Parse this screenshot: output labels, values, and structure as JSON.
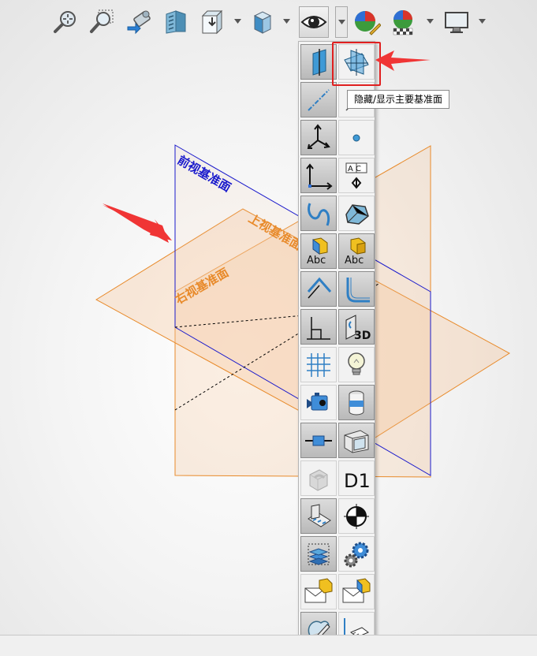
{
  "viewport": {
    "planes": {
      "front": {
        "label": "前视基准面",
        "color": "#1a1acc"
      },
      "top": {
        "label": "上视基准面",
        "color": "#e88a2a"
      },
      "right": {
        "label": "右视基准面",
        "color": "#e88a2a"
      }
    }
  },
  "toolbar": {
    "buttons": [
      {
        "name": "zoom-to-fit-icon"
      },
      {
        "name": "zoom-to-area-icon"
      },
      {
        "name": "previous-view-icon"
      },
      {
        "name": "section-view-icon"
      },
      {
        "name": "view-orientation-icon"
      },
      {
        "name": "display-style-icon"
      },
      {
        "name": "hide-show-items-icon"
      },
      {
        "name": "edit-appearance-icon"
      },
      {
        "name": "apply-scene-icon"
      },
      {
        "name": "view-settings-icon"
      }
    ]
  },
  "flyout": {
    "tooltip": "隐藏/显示主要基准面",
    "d1_label": "D1",
    "abc_label": "Abc",
    "ac_label": "A C",
    "threed_label": "3D"
  },
  "colors": {
    "highlight": "#e02020",
    "arrow": "#f03535",
    "front_plane": "#1a1acc",
    "orange_plane": "#e88a2a"
  }
}
